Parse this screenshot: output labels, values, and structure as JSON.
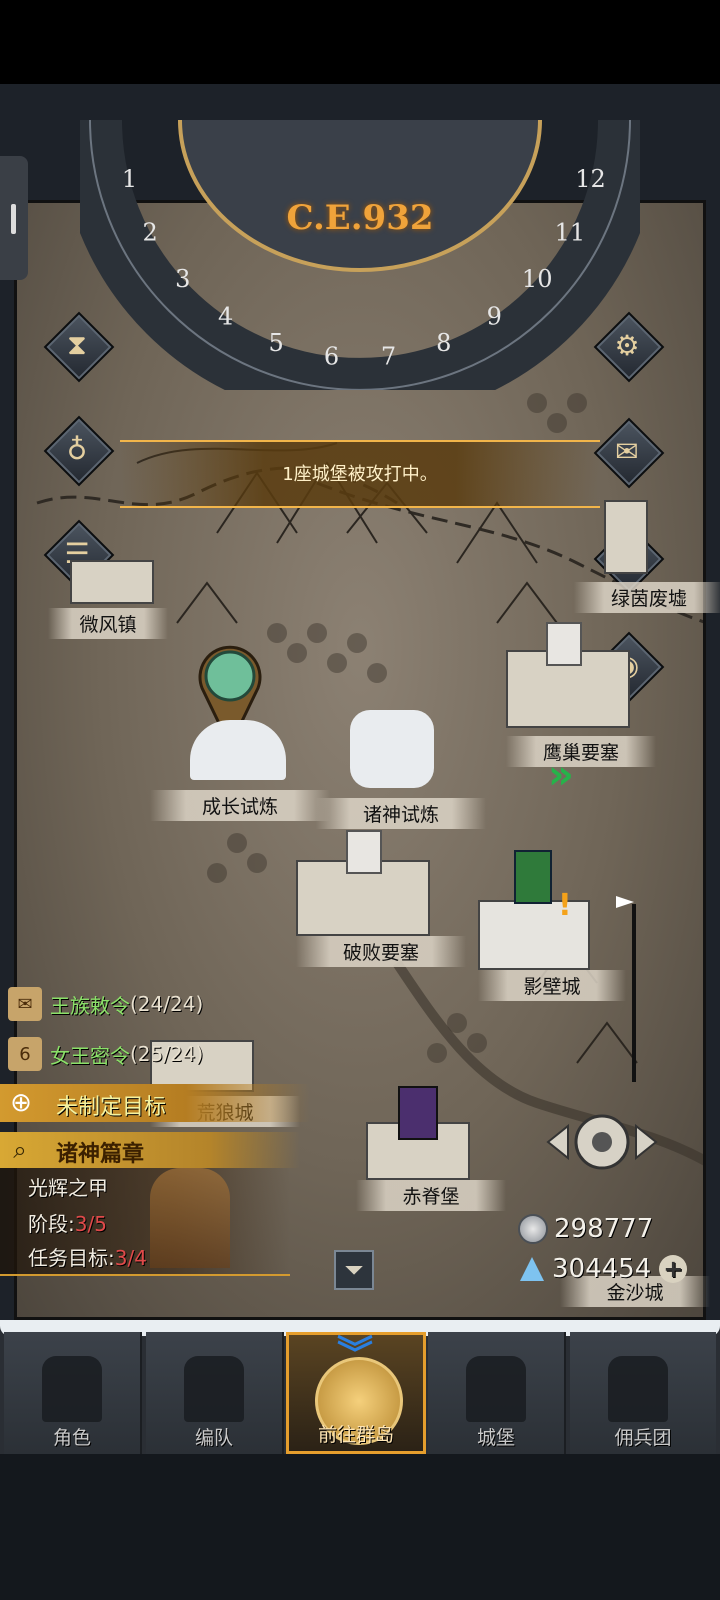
{
  "calendar": {
    "year": "C.E.932",
    "months": [
      "1",
      "2",
      "3",
      "4",
      "5",
      "6",
      "7",
      "8",
      "9",
      "10",
      "11",
      "12"
    ]
  },
  "banner": {
    "text": "1座城堡被攻打中。"
  },
  "locations": {
    "weifeng": "微风镇",
    "lvyin": "绿茵废墟",
    "yingchou": "鹰巢要塞",
    "chengzhang": "成长试炼",
    "zhushen": "诸神试炼",
    "pobai": "破败要塞",
    "yingbi": "影壁城",
    "huanglang": "荒狼城",
    "chiji": "赤脊堡",
    "jinsha": "金沙城"
  },
  "quests": {
    "royal_order": {
      "label": "王族敕令",
      "count": "(24/24)"
    },
    "queen_order": {
      "label": "女王密令",
      "count": "(25/24)"
    },
    "goal": {
      "label": "未制定目标"
    },
    "chapter": {
      "label": "诸神篇章",
      "title": "光辉之甲",
      "stage_label": "阶段:",
      "stage_value": "3/5",
      "task_label": "任务目标:",
      "task_value": "3/4"
    }
  },
  "currency": {
    "silver": "298777",
    "crystal": "304454"
  },
  "nav": {
    "items": [
      {
        "label": "角色"
      },
      {
        "label": "编队"
      },
      {
        "label": "前往群岛"
      },
      {
        "label": "城堡"
      },
      {
        "label": "佣兵团"
      }
    ],
    "active_index": 2
  },
  "colors": {
    "accent": "#e59e2d",
    "quest_green": "#8be069",
    "progress_red": "#e04a4a"
  }
}
